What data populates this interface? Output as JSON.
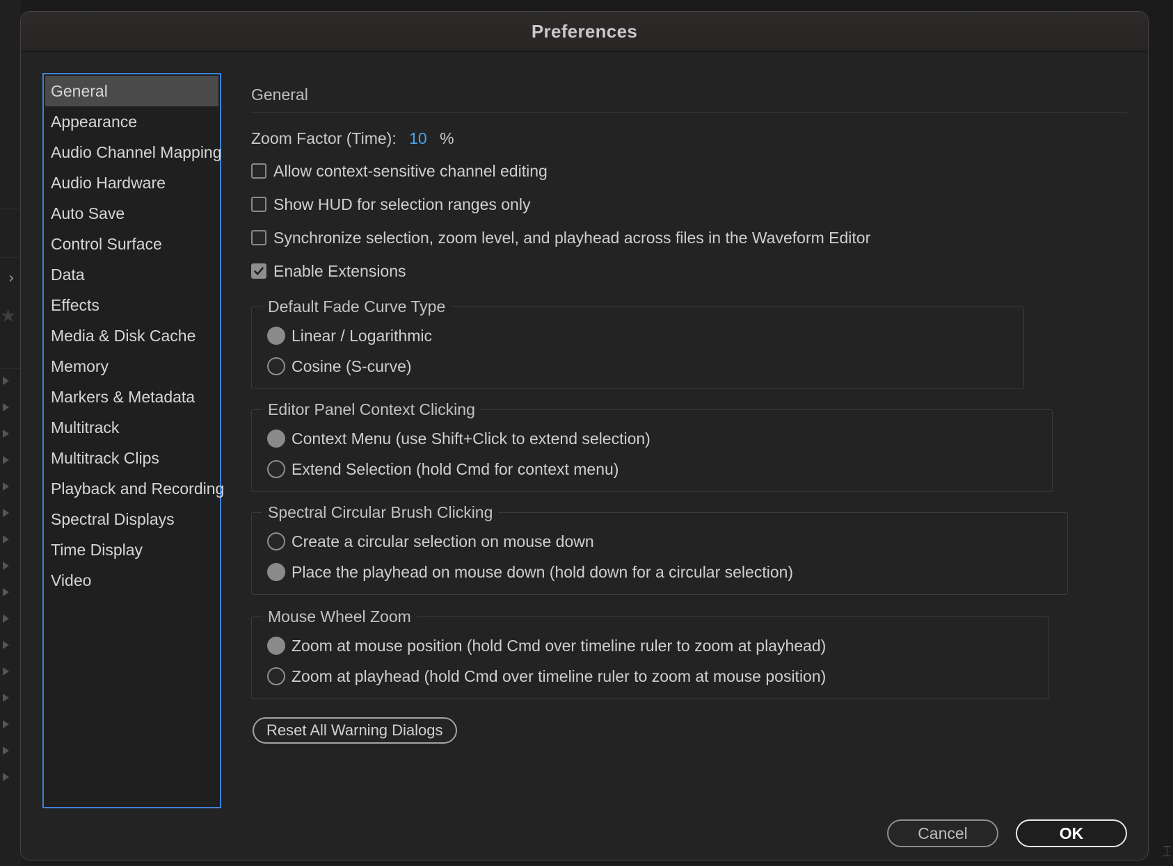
{
  "dialog": {
    "title": "Preferences"
  },
  "sidebar": {
    "items": [
      {
        "label": "General"
      },
      {
        "label": "Appearance"
      },
      {
        "label": "Audio Channel Mapping"
      },
      {
        "label": "Audio Hardware"
      },
      {
        "label": "Auto Save"
      },
      {
        "label": "Control Surface"
      },
      {
        "label": "Data"
      },
      {
        "label": "Effects"
      },
      {
        "label": "Media & Disk Cache"
      },
      {
        "label": "Memory"
      },
      {
        "label": "Markers & Metadata"
      },
      {
        "label": "Multitrack"
      },
      {
        "label": "Multitrack Clips"
      },
      {
        "label": "Playback and Recording"
      },
      {
        "label": "Spectral Displays"
      },
      {
        "label": "Time Display"
      },
      {
        "label": "Video"
      }
    ],
    "selected": "General"
  },
  "general": {
    "heading": "General",
    "zoom": {
      "label": "Zoom Factor (Time):",
      "value": "10",
      "unit": "%"
    },
    "checkboxes": [
      {
        "label": "Allow context-sensitive channel editing",
        "checked": false
      },
      {
        "label": "Show HUD for selection ranges only",
        "checked": false
      },
      {
        "label": "Synchronize selection, zoom level, and playhead across files in the Waveform Editor",
        "checked": false
      },
      {
        "label": "Enable Extensions",
        "checked": true
      }
    ],
    "fade_curve": {
      "legend": "Default Fade Curve Type",
      "options": [
        {
          "label": "Linear / Logarithmic",
          "selected": true
        },
        {
          "label": "Cosine (S-curve)",
          "selected": false
        }
      ]
    },
    "context_clicking": {
      "legend": "Editor Panel Context Clicking",
      "options": [
        {
          "label": "Context Menu (use Shift+Click to extend selection)",
          "selected": true
        },
        {
          "label": "Extend Selection (hold Cmd for context menu)",
          "selected": false
        }
      ]
    },
    "brush_clicking": {
      "legend": "Spectral Circular Brush Clicking",
      "options": [
        {
          "label": "Create a circular selection on mouse down",
          "selected": false
        },
        {
          "label": "Place the playhead on mouse down (hold down for a circular selection)",
          "selected": true
        }
      ]
    },
    "wheel_zoom": {
      "legend": "Mouse Wheel Zoom",
      "options": [
        {
          "label": "Zoom at mouse position (hold Cmd over timeline ruler to zoom at playhead)",
          "selected": true
        },
        {
          "label": "Zoom at playhead (hold Cmd over timeline ruler to zoom at mouse position)",
          "selected": false
        }
      ]
    },
    "reset_label": "Reset All Warning Dialogs"
  },
  "footer": {
    "cancel_label": "Cancel",
    "ok_label": "OK"
  },
  "colors": {
    "accent": "#3c82d8",
    "value_blue": "#4ba3ec",
    "background": "#232323"
  }
}
